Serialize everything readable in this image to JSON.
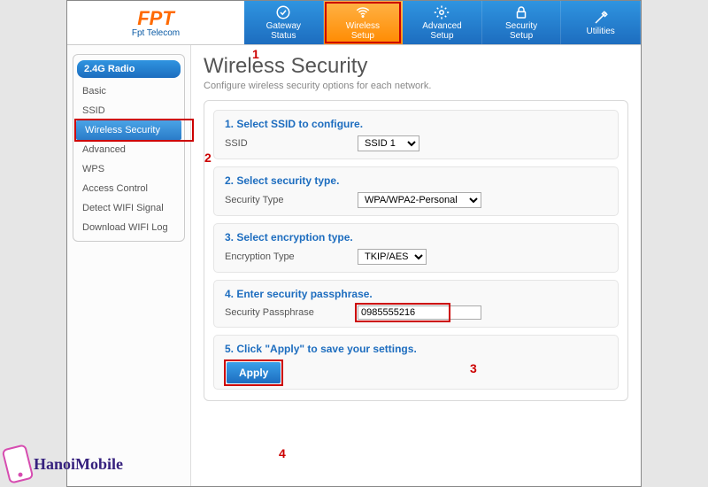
{
  "logo": {
    "brand": "FPT",
    "sub": "Fpt Telecom"
  },
  "nav": {
    "items": [
      {
        "label": "Gateway\nStatus",
        "icon": "check-circle-icon"
      },
      {
        "label": "Wireless\nSetup",
        "icon": "wifi-icon",
        "active": true
      },
      {
        "label": "Advanced\nSetup",
        "icon": "gear-icon"
      },
      {
        "label": "Security\nSetup",
        "icon": "lock-icon"
      },
      {
        "label": "Utilities",
        "icon": "tools-icon"
      }
    ]
  },
  "sidebar": {
    "heading": "2.4G Radio",
    "items": [
      "Basic",
      "SSID",
      "Wireless Security",
      "Advanced",
      "WPS",
      "Access Control",
      "Detect WIFI Signal",
      "Download WIFI Log"
    ],
    "activeIndex": 2
  },
  "page": {
    "title": "Wireless Security",
    "subtitle": "Configure wireless security options for each network."
  },
  "sections": {
    "s1": {
      "title": "1. Select SSID to configure.",
      "label": "SSID",
      "value": "SSID 1"
    },
    "s2": {
      "title": "2. Select security type.",
      "label": "Security Type",
      "value": "WPA/WPA2-Personal"
    },
    "s3": {
      "title": "3. Select encryption type.",
      "label": "Encryption Type",
      "value": "TKIP/AES"
    },
    "s4": {
      "title": "4. Enter security passphrase.",
      "label": "Security Passphrase",
      "value": "0985555216"
    },
    "s5": {
      "title": "5. Click \"Apply\" to save your settings.",
      "button": "Apply"
    }
  },
  "annotations": {
    "a1": "1",
    "a2": "2",
    "a3": "3",
    "a4": "4"
  },
  "watermark": "HanoiMobile"
}
